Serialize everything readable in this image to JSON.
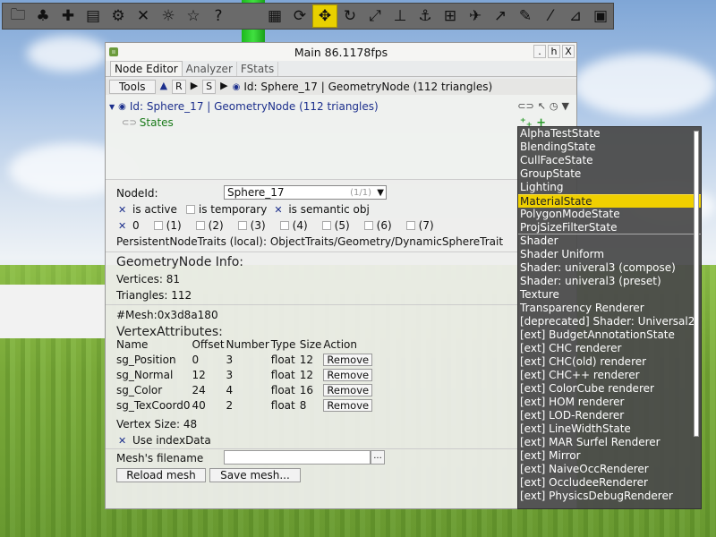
{
  "toolbar": {
    "buttons": [
      {
        "icon": "folder-icon",
        "glyph": "🗀"
      },
      {
        "icon": "tree-icon",
        "glyph": "♣"
      },
      {
        "icon": "puzzle-icon",
        "glyph": "✚"
      },
      {
        "icon": "list-icon",
        "glyph": "▤"
      },
      {
        "icon": "gear-icon",
        "glyph": "⚙"
      },
      {
        "icon": "tools-icon",
        "glyph": "✕"
      },
      {
        "icon": "light-icon",
        "glyph": "☼"
      },
      {
        "icon": "star-icon",
        "glyph": "☆"
      },
      {
        "icon": "help-icon",
        "glyph": "?"
      }
    ],
    "buttons2": [
      {
        "icon": "numpad-icon",
        "glyph": "▦"
      },
      {
        "icon": "rotate-box-icon",
        "glyph": "⟳"
      },
      {
        "icon": "move-icon",
        "glyph": "✥"
      },
      {
        "icon": "rotate-icon",
        "glyph": "↻"
      },
      {
        "icon": "scale-icon",
        "glyph": "⤢"
      },
      {
        "icon": "align-vertical-icon",
        "glyph": "⊥"
      },
      {
        "icon": "anchor-icon",
        "glyph": "⚓"
      },
      {
        "icon": "measure-icon",
        "glyph": "⊞"
      },
      {
        "icon": "navigate-icon",
        "glyph": "✈"
      },
      {
        "icon": "ray-icon",
        "glyph": "↗"
      },
      {
        "icon": "edit-icon",
        "glyph": "✎"
      },
      {
        "icon": "draw-icon",
        "glyph": "⁄"
      },
      {
        "icon": "select-icon",
        "glyph": "⊿"
      },
      {
        "icon": "notes-icon",
        "glyph": "▣"
      }
    ]
  },
  "window": {
    "title": "Main 86.1178fps",
    "controls": [
      ".",
      "h",
      "X"
    ],
    "tabs": [
      "Node Editor",
      "Analyzer",
      "FStats"
    ],
    "toolsbar": {
      "tools": "Tools",
      "up": "▲",
      "r": "R",
      "play": "▶",
      "s": "S",
      "play2": "▶",
      "path": "Id: Sphere_17 | GeometryNode (112 triangles)"
    },
    "tree": {
      "node": "Id: Sphere_17 | GeometryNode (112 triangles)",
      "child": "States"
    },
    "props": {
      "nodeid_label": "NodeId:",
      "nodeid_value": "Sphere_17",
      "nodeid_hint": "(1/1)",
      "is_active": "is active",
      "is_temporary": "is temporary",
      "is_semantic": "is semantic obj",
      "flags": [
        "0",
        "(1)",
        "(2)",
        "(3)",
        "(4)",
        "(5)",
        "(6)",
        "(7)"
      ],
      "traits": "PersistentNodeTraits (local): ObjectTraits/Geometry/DynamicSphereTrait",
      "geo_header": "GeometryNode Info:",
      "vertices": "Vertices: 81",
      "triangles": "Triangles: 112",
      "mesh": "#Mesh:0x3d8a180",
      "va_header": "VertexAttributes:",
      "va_columns": [
        "Name",
        "Offset",
        "Number",
        "Type",
        "Size",
        "Action"
      ],
      "va_rows": [
        [
          "sg_Position",
          "0",
          "3",
          "float",
          "12",
          "Remove"
        ],
        [
          "sg_Normal",
          "12",
          "3",
          "float",
          "12",
          "Remove"
        ],
        [
          "sg_Color",
          "24",
          "4",
          "float",
          "16",
          "Remove"
        ],
        [
          "sg_TexCoord0",
          "40",
          "2",
          "float",
          "8",
          "Remove"
        ]
      ],
      "vertex_size": "Vertex Size: 48",
      "use_index": "Use indexData",
      "filename_label": "Mesh's filename",
      "dots": "...",
      "reload": "Reload mesh",
      "save": "Save mesh..."
    }
  },
  "dropdown": {
    "items": [
      "AlphaTestState",
      "BlendingState",
      "CullFaceState",
      "GroupState",
      "Lighting",
      "MaterialState",
      "PolygonModeState",
      "ProjSizeFilterState",
      "Shader",
      "Shader Uniform",
      "Shader: univeral3 (compose)",
      "Shader: univeral3 (preset)",
      "Texture",
      "Transparency Renderer",
      "[deprecated] Shader: Universal2",
      "[ext] BudgetAnnotationState",
      "[ext] CHC renderer",
      "[ext] CHC(old) renderer",
      "[ext] CHC++ renderer",
      "[ext] ColorCube renderer",
      "[ext] HOM renderer",
      "[ext] LOD-Renderer",
      "[ext] LineWidthState",
      "[ext] MAR Surfel Renderer",
      "[ext] Mirror",
      "[ext] NaiveOccRenderer",
      "[ext] OccludeeRenderer",
      "[ext] PhysicsDebugRenderer"
    ],
    "selected_index": 5,
    "outlined_index": 7
  }
}
